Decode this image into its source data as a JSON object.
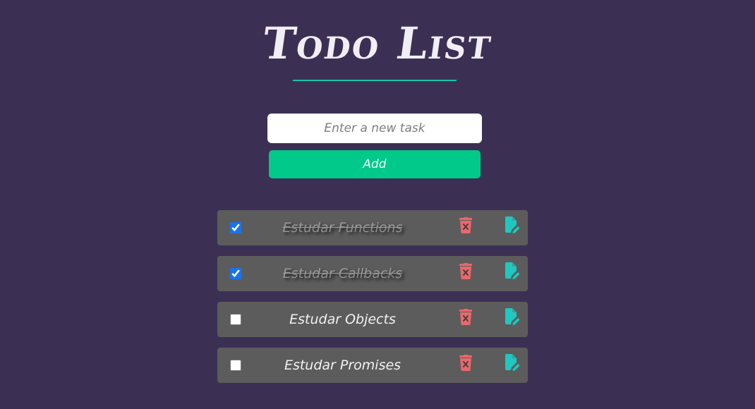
{
  "app": {
    "title": "Todo List"
  },
  "form": {
    "input_value": "",
    "input_placeholder": "Enter a new task",
    "add_label": "Add"
  },
  "tasks": [
    {
      "label": "Estudar Functions",
      "done": true
    },
    {
      "label": "Estudar Callbacks",
      "done": true
    },
    {
      "label": "Estudar Objects",
      "done": false
    },
    {
      "label": "Estudar Promises",
      "done": false
    }
  ],
  "icons": {
    "delete": "trash-x-icon",
    "edit": "file-edit-icon"
  },
  "colors": {
    "background": "#3b3054",
    "accent_line": "#16c7a6",
    "add_button": "#00c98a",
    "task_bg": "#5d5c5c",
    "delete_icon": "#e9686b",
    "edit_icon": "#1fc7c1"
  }
}
